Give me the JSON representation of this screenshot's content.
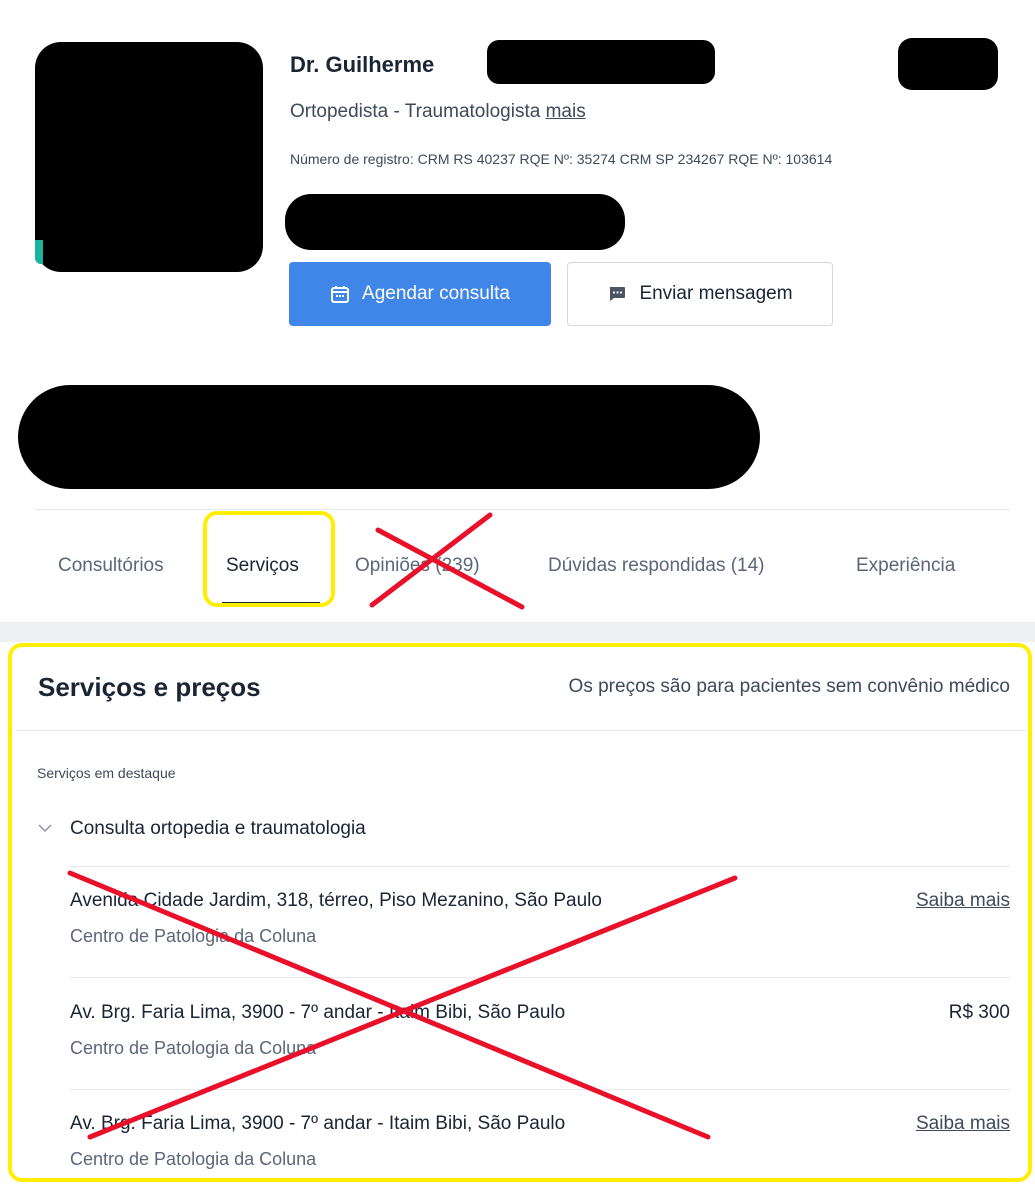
{
  "profile": {
    "name": "Dr. Guilherme",
    "specialty": "Ortopedista - Traumatologista",
    "specialty_more": "mais",
    "registry": "Número de registro: CRM RS 40237 RQE Nº: 35274 CRM SP 234267 RQE Nº: 103614"
  },
  "actions": {
    "book_label": "Agendar consulta",
    "message_label": "Enviar mensagem"
  },
  "tabs": [
    {
      "label": "Consultórios"
    },
    {
      "label": "Serviços"
    },
    {
      "label": "Opiniões (239)"
    },
    {
      "label": "Dúvidas respondidas (14)"
    },
    {
      "label": "Experiência"
    }
  ],
  "services": {
    "title": "Serviços e preços",
    "note": "Os preços são para pacientes sem convênio médico",
    "featured_label": "Serviços em destaque",
    "service_name": "Consulta ortopedia e traumatologia",
    "rows": [
      {
        "address": "Avenida Cidade Jardim, 318, térreo, Piso Mezanino, São Paulo",
        "clinic": "Centro de Patologia da Coluna",
        "right": "Saiba mais"
      },
      {
        "address": "Av. Brg. Faria Lima, 3900 - 7º andar - Itaim Bibi, São Paulo",
        "clinic": "Centro de Patologia da Coluna",
        "right": "R$ 300"
      },
      {
        "address": "Av. Brg. Faria Lima, 3900 - 7º andar - Itaim Bibi, São Paulo",
        "clinic": "Centro de Patologia da Coluna",
        "right": "Saiba mais"
      }
    ]
  },
  "colors": {
    "primary": "#3f86e8",
    "highlight": "#ffee00",
    "cross": "#e8102a",
    "redaction": "#000000"
  }
}
